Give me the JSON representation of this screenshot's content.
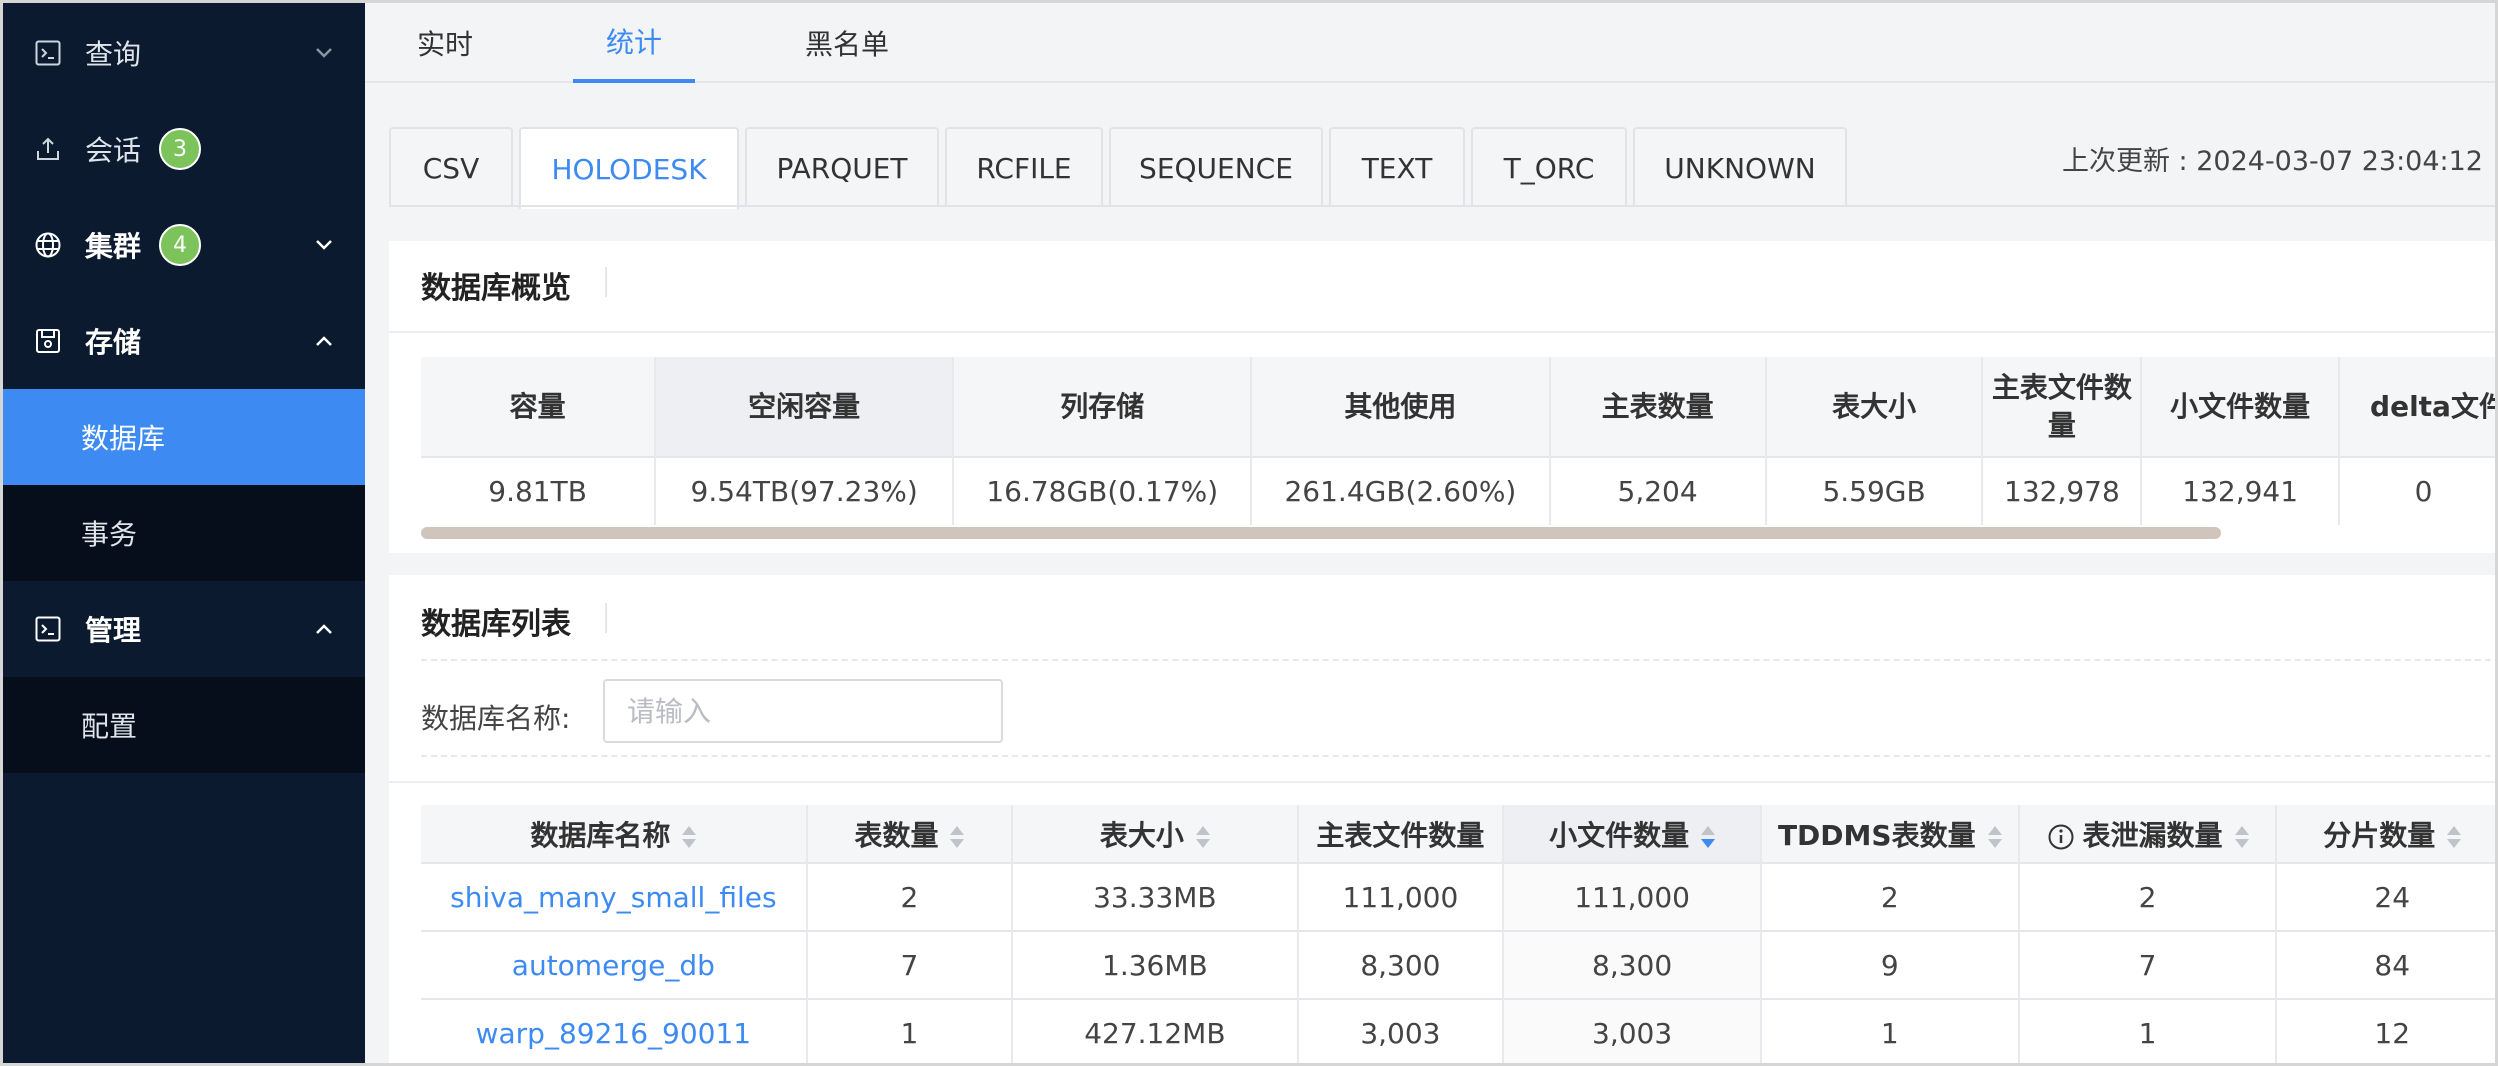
{
  "sidebar": {
    "items": [
      {
        "label": "查询",
        "icon": "terminal-icon"
      },
      {
        "label": "会话",
        "icon": "upload-icon",
        "badge": "3"
      },
      {
        "label": "集群",
        "icon": "globe-icon",
        "badge": "4"
      },
      {
        "label": "存储",
        "icon": "disk-icon"
      },
      {
        "label": "数据库"
      },
      {
        "label": "事务"
      },
      {
        "label": "管理",
        "icon": "terminal-icon"
      },
      {
        "label": "配置"
      }
    ],
    "active_color": "#3d8bf2",
    "badge_color": "#7cc35b"
  },
  "top_tabs": [
    "实时",
    "统计",
    "黑名单"
  ],
  "active_top_tab": "统计",
  "format_tabs": [
    "CSV",
    "HOLODESK",
    "PARQUET",
    "RCFILE",
    "SEQUENCE",
    "TEXT",
    "T_ORC",
    "UNKNOWN"
  ],
  "active_format_tab": "HOLODESK",
  "last_update": "上次更新 : 2024-03-07 23:04:12",
  "overview": {
    "title": "数据库概览",
    "columns": [
      "容量",
      "空闲容量",
      "列存储",
      "其他使用",
      "主表数量",
      "表大小",
      "主表文件数量",
      "小文件数量",
      "delta文件"
    ],
    "values": [
      "9.81TB",
      "9.54TB(97.23%)",
      "16.78GB(0.17%)",
      "261.4GB(2.60%)",
      "5,204",
      "5.59GB",
      "132,978",
      "132,941",
      "0"
    ]
  },
  "db_list": {
    "title": "数据库列表",
    "search_label": "数据库名称:",
    "search_placeholder": "请输入",
    "columns": [
      "数据库名称",
      "表数量",
      "表大小",
      "主表文件数量",
      "小文件数量",
      "TDDMS表数量",
      "表泄漏数量",
      "分片数量"
    ],
    "rows": [
      [
        "shiva_many_small_files",
        "2",
        "33.33MB",
        "111,000",
        "111,000",
        "2",
        "2",
        "24"
      ],
      [
        "automerge_db",
        "7",
        "1.36MB",
        "8,300",
        "8,300",
        "9",
        "7",
        "84"
      ],
      [
        "warp_89216_90011",
        "1",
        "427.12MB",
        "3,003",
        "3,003",
        "1",
        "1",
        "12"
      ]
    ]
  }
}
